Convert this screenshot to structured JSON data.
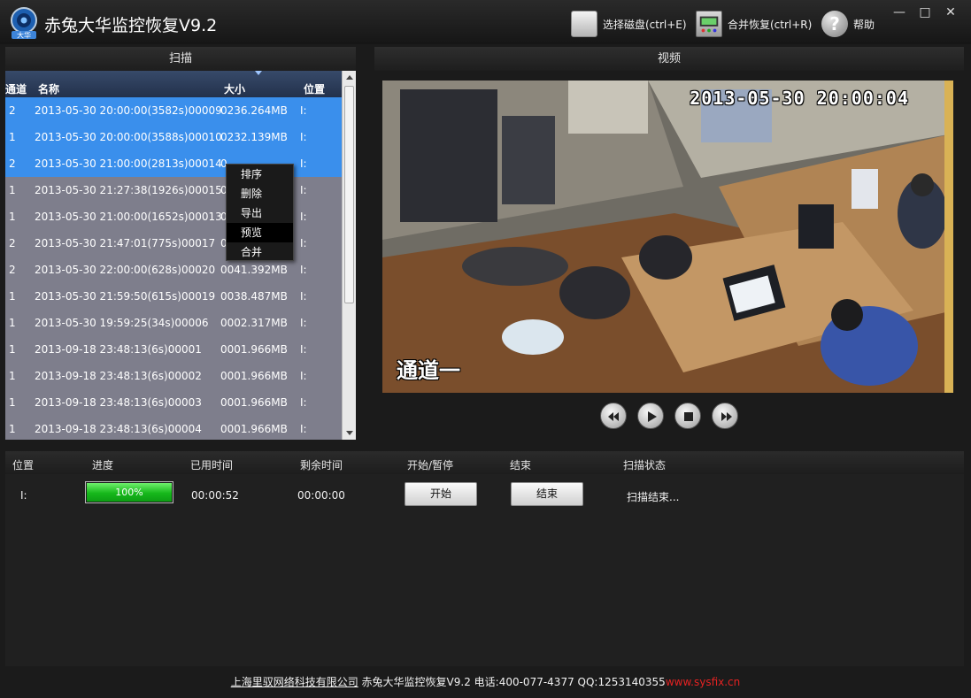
{
  "app": {
    "title": "赤兔大华监控恢复V9.2",
    "logo_text": "大华",
    "toolbar": [
      {
        "label": "选择磁盘(ctrl+E)",
        "icon": "disk-icon"
      },
      {
        "label": "合并恢复(ctrl+R)",
        "icon": "merge-icon"
      },
      {
        "label": "帮助",
        "icon": "help-icon"
      }
    ],
    "window_controls": {
      "minimize": "—",
      "maximize": "□",
      "close": "✕"
    }
  },
  "scan_panel": {
    "title": "扫描",
    "columns": {
      "channel": "通道",
      "name": "名称",
      "size": "大小",
      "position": "位置"
    },
    "rows": [
      {
        "channel": "2",
        "name": "2013-05-30 20:00:00(3582s)00009",
        "size": "0236.264MB",
        "position": "I:",
        "selected": true
      },
      {
        "channel": "1",
        "name": "2013-05-30 20:00:00(3588s)00010",
        "size": "0232.139MB",
        "position": "I:",
        "selected": true
      },
      {
        "channel": "2",
        "name": "2013-05-30 21:00:00(2813s)00014",
        "size": "0",
        "position": "I:",
        "selected": true
      },
      {
        "channel": "1",
        "name": "2013-05-30 21:27:38(1926s)00015",
        "size": "0",
        "position": "I:",
        "selected": false
      },
      {
        "channel": "1",
        "name": "2013-05-30 21:00:00(1652s)00013",
        "size": "0",
        "position": "I:",
        "selected": false
      },
      {
        "channel": "2",
        "name": "2013-05-30 21:47:01(775s)00017",
        "size": "0",
        "position": "I:",
        "selected": false
      },
      {
        "channel": "2",
        "name": "2013-05-30 22:00:00(628s)00020",
        "size": "0041.392MB",
        "position": "I:",
        "selected": false
      },
      {
        "channel": "1",
        "name": "2013-05-30 21:59:50(615s)00019",
        "size": "0038.487MB",
        "position": "I:",
        "selected": false
      },
      {
        "channel": "1",
        "name": "2013-05-30 19:59:25(34s)00006",
        "size": "0002.317MB",
        "position": "I:",
        "selected": false
      },
      {
        "channel": "1",
        "name": "2013-09-18 23:48:13(6s)00001",
        "size": "0001.966MB",
        "position": "I:",
        "selected": false
      },
      {
        "channel": "1",
        "name": "2013-09-18 23:48:13(6s)00002",
        "size": "0001.966MB",
        "position": "I:",
        "selected": false
      },
      {
        "channel": "1",
        "name": "2013-09-18 23:48:13(6s)00003",
        "size": "0001.966MB",
        "position": "I:",
        "selected": false
      },
      {
        "channel": "1",
        "name": "2013-09-18 23:48:13(6s)00004",
        "size": "0001.966MB",
        "position": "I:",
        "selected": false
      }
    ],
    "context_menu": [
      "排序",
      "删除",
      "导出",
      "预览",
      "合并"
    ],
    "context_menu_highlighted": 3
  },
  "video_panel": {
    "title": "视频",
    "osd_timestamp": "2013-05-30 20:00:04",
    "osd_channel": "通道一",
    "controls": [
      "rewind-button",
      "play-button",
      "stop-button",
      "fast-forward-button"
    ]
  },
  "task_panel": {
    "columns": {
      "position": "位置",
      "progress": "进度",
      "elapsed": "已用时间",
      "remaining": "剩余时间",
      "start_pause": "开始/暂停",
      "end": "结束",
      "status": "扫描状态"
    },
    "row": {
      "position": "I:",
      "progress_percent": 100,
      "progress_label": "100%",
      "elapsed": "00:00:52",
      "remaining": "00:00:00",
      "start_label": "开始",
      "end_label": "结束",
      "status": "扫描结束..."
    }
  },
  "footer": {
    "company": "上海里驭网络科技有限公司",
    "text": " 赤兔大华监控恢复V9.2 电话:400-077-4377 QQ:1253140355",
    "url": "www.sysfix.cn"
  },
  "colors": {
    "selection": "#3a8fec",
    "list_bg": "#7e7e8c",
    "progress_green": "#16b81b",
    "footer_url": "#e52222"
  }
}
